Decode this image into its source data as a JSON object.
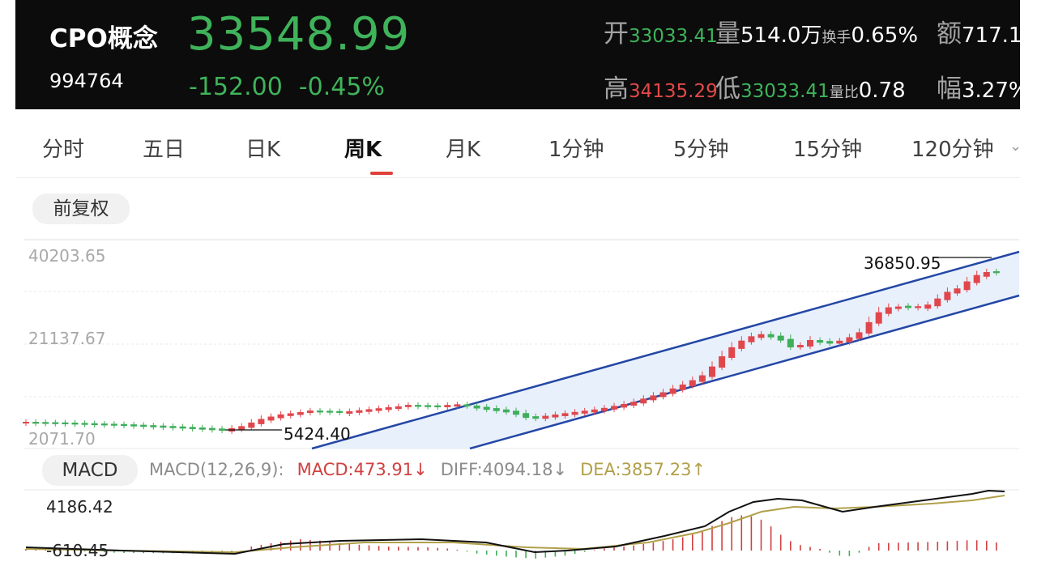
{
  "header": {
    "name": "CPO概念",
    "code": "994764",
    "price": "33548.99",
    "change": "-152.00",
    "change_pct": "-0.45%",
    "open_label": "开",
    "open_value": "33033.41",
    "volume_label": "量",
    "volume_value": "514.0万",
    "turnover_label": "换手",
    "turnover_value": "0.65%",
    "amount_label": "额",
    "amount_value": "717.1",
    "high_label": "高",
    "high_value": "34135.29",
    "low_label": "低",
    "low_value": "33033.41",
    "vol_ratio_label": "量比",
    "vol_ratio_value": "0.78",
    "amplitude_label": "幅",
    "amplitude_value": "3.27%"
  },
  "tabs": [
    {
      "label": "分时"
    },
    {
      "label": "五日"
    },
    {
      "label": "日K"
    },
    {
      "label": "周K",
      "active": true
    },
    {
      "label": "月K"
    },
    {
      "label": "1分钟"
    },
    {
      "label": "5分钟"
    },
    {
      "label": "15分钟"
    },
    {
      "label": "120分钟"
    }
  ],
  "adjust_button": "前复权",
  "kline": {
    "y_labels": [
      "40203.65",
      "21137.67",
      "2071.70"
    ],
    "low_mark": "5424.40",
    "high_mark": "36850.95",
    "colors": {
      "up": "#e0474c",
      "down": "#3fae5a",
      "channel": "#2447a6",
      "channel_fill": "#e8f0fb"
    }
  },
  "macd": {
    "button": "MACD",
    "params": "MACD(12,26,9):",
    "macd": "MACD:473.91↓",
    "diff": "DIFF:4094.18↓",
    "dea": "DEA:3857.23↑",
    "y_labels": [
      "4186.42",
      "-610.45"
    ],
    "colors": {
      "diff": "#111111",
      "dea": "#b1a04a",
      "bar_pos": "#d14040",
      "bar_neg": "#3fae5a"
    }
  }
}
